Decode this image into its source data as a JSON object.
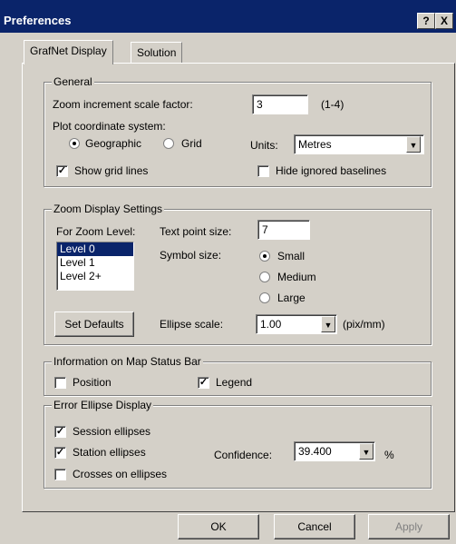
{
  "window": {
    "title": "Preferences",
    "help_label": "?",
    "close_label": "X"
  },
  "tabs": [
    {
      "label": "GrafNet Display",
      "active": true
    },
    {
      "label": "Solution",
      "active": false
    }
  ],
  "general": {
    "group_label": "General",
    "zoom_label": "Zoom increment scale factor:",
    "zoom_value": "3",
    "zoom_range": "(1-4)",
    "plot_label": "Plot coordinate system:",
    "radio_geographic": "Geographic",
    "radio_grid": "Grid",
    "selected_coordinate": "Geographic",
    "units_label": "Units:",
    "units_value": "Metres",
    "show_grid_label": "Show grid lines",
    "show_grid_checked": true,
    "hide_ignored_label": "Hide ignored baselines",
    "hide_ignored_checked": false
  },
  "zoom_display": {
    "group_label": "Zoom Display Settings",
    "for_level_label": "For Zoom Level:",
    "levels": [
      "Level 0",
      "Level 1",
      "Level 2+"
    ],
    "selected_level": "Level 0",
    "text_point_label": "Text point size:",
    "text_point_value": "7",
    "symbol_label": "Symbol size:",
    "symbol_small": "Small",
    "symbol_medium": "Medium",
    "symbol_large": "Large",
    "selected_symbol": "Small",
    "set_defaults_label": "Set Defaults",
    "ellipse_label": "Ellipse scale:",
    "ellipse_value": "1.00",
    "ellipse_unit": "(pix/mm)"
  },
  "status_bar": {
    "group_label": "Information on Map Status Bar",
    "position_label": "Position",
    "position_checked": false,
    "legend_label": "Legend",
    "legend_checked": true
  },
  "error_ellipse": {
    "group_label": "Error Ellipse Display",
    "session_label": "Session ellipses",
    "session_checked": true,
    "station_label": "Station ellipses",
    "station_checked": true,
    "crosses_label": "Crosses on ellipses",
    "crosses_checked": false,
    "confidence_label": "Confidence:",
    "confidence_value": "39.400",
    "confidence_unit": "%"
  },
  "buttons": {
    "ok": "OK",
    "cancel": "Cancel",
    "apply": "Apply"
  },
  "colors": {
    "titlebar": "#0a246a",
    "face": "#d4d0c8",
    "selection": "#0a246a"
  }
}
